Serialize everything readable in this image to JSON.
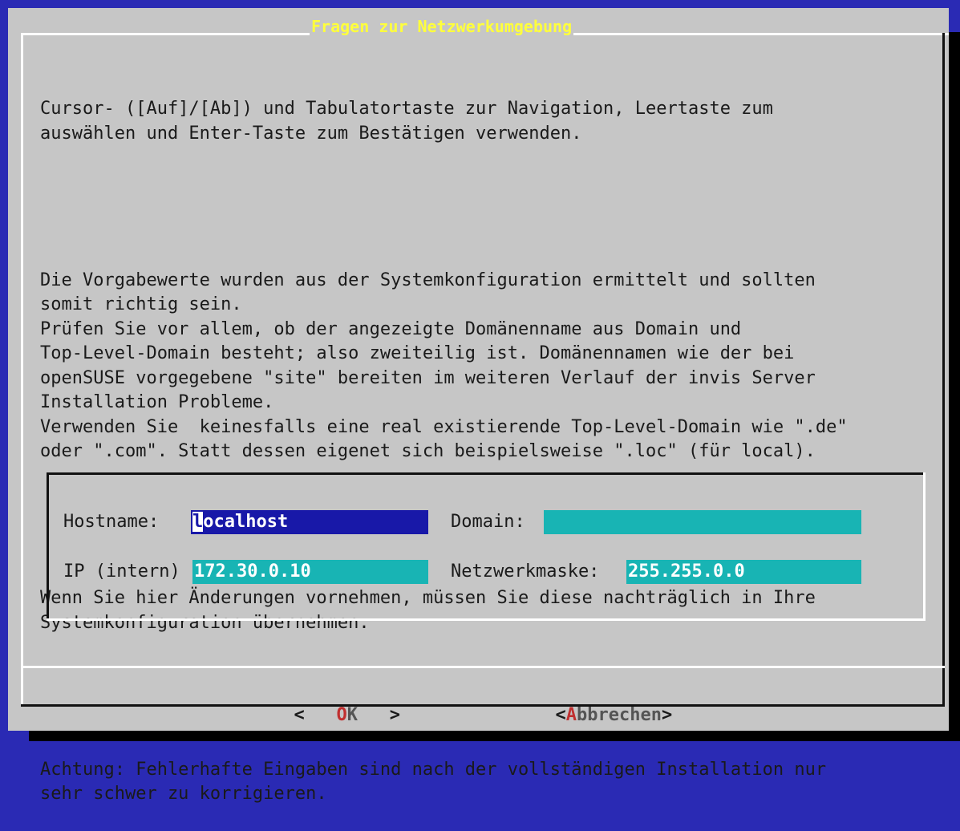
{
  "dialog": {
    "title": "Fragen zur Netzwerkumgebung",
    "paragraphs": [
      "Cursor- ([Auf]/[Ab]) und Tabulatortaste zur Navigation, Leertaste zum\nauswählen und Enter-Taste zum Bestätigen verwenden.",
      "Die Vorgabewerte wurden aus der Systemkonfiguration ermittelt und sollten\nsomit richtig sein.\nPrüfen Sie vor allem, ob der angezeigte Domänenname aus Domain und\nTop-Level-Domain besteht; also zweiteilig ist. Domänennamen wie der bei\nopenSUSE vorgegebene \"site\" bereiten im weiteren Verlauf der invis Server\nInstallation Probleme.\nVerwenden Sie  keinesfalls eine real existierende Top-Level-Domain wie \".de\"\noder \".com\". Statt dessen eigenet sich beispielsweise \".loc\" (für local).",
      "Wenn Sie hier Änderungen vornehmen, müssen Sie diese nachträglich in Ihre\nSystemkonfiguration übernehmen.",
      "Achtung: Fehlerhafte Eingaben sind nach der vollständigen Installation nur\nsehr schwer zu korrigieren."
    ]
  },
  "form": {
    "hostname_label": "Hostname:",
    "hostname_cursor_char": "l",
    "hostname_rest": "ocalhost",
    "domain_label": "Domain:",
    "domain_value": "",
    "ip_label": "IP (intern)",
    "ip_value": "172.30.0.10",
    "netmask_label": "Netzwerkmaske:",
    "netmask_value": "255.255.0.0"
  },
  "buttons": {
    "ok": {
      "left": "<",
      "hotkey": "O",
      "rest": "K",
      "right": ">"
    },
    "cancel": {
      "left": "<",
      "hotkey": "A",
      "rest": "bbrechen",
      "right": ">"
    }
  },
  "colors": {
    "screen_bg": "#2a2ab4",
    "dialog_bg": "#c6c6c6",
    "title": "#ffff3c",
    "field_focused": "#1818a8",
    "field_normal": "#18b4b4",
    "hotkey": "#c03030"
  }
}
